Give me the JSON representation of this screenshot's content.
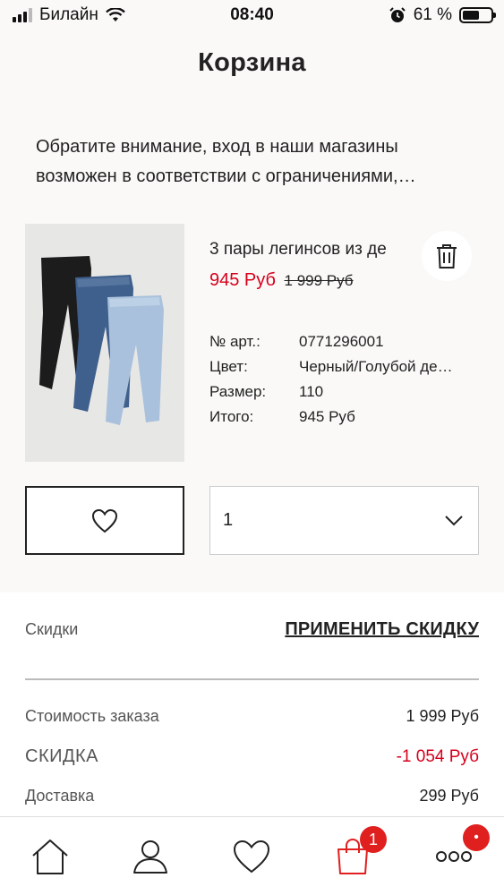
{
  "status_bar": {
    "carrier": "Билайн",
    "time": "08:40",
    "battery_percent": "61 %",
    "battery_level": 0.61
  },
  "header": {
    "title": "Корзина"
  },
  "notice": {
    "text": "Обратите внимание, вход в наши магазины возможен в соответствии с ограничениями,…"
  },
  "cart_item": {
    "name": "3 пары легинсов из де",
    "price_current": "945 Руб",
    "price_old": "1 999 Руб",
    "details": [
      {
        "label": "№ арт.:",
        "value": "0771296001"
      },
      {
        "label": "Цвет:",
        "value": "Черный/Голубой де…"
      },
      {
        "label": "Размер:",
        "value": "110"
      },
      {
        "label": "Итого:",
        "value": "945 Руб"
      }
    ],
    "quantity": "1"
  },
  "summary": {
    "discounts_label": "Скидки",
    "apply_discount": "ПРИМЕНИТЬ СКИДКУ",
    "rows": [
      {
        "label": "Стоимость заказа",
        "value": "1 999 Руб"
      },
      {
        "label": "СКИДКА",
        "value": "-1 054 Руб"
      },
      {
        "label": "Доставка",
        "value": "299 Руб"
      }
    ]
  },
  "tab_bar": {
    "tabs": [
      "home-icon",
      "account-icon",
      "favorites-icon",
      "cart-icon",
      "more-icon"
    ],
    "cart_badge": "1",
    "more_badge": "•"
  },
  "colors": {
    "accent_red": "#d6001c",
    "badge_red": "#e0201f",
    "background": "#faf9f8"
  }
}
